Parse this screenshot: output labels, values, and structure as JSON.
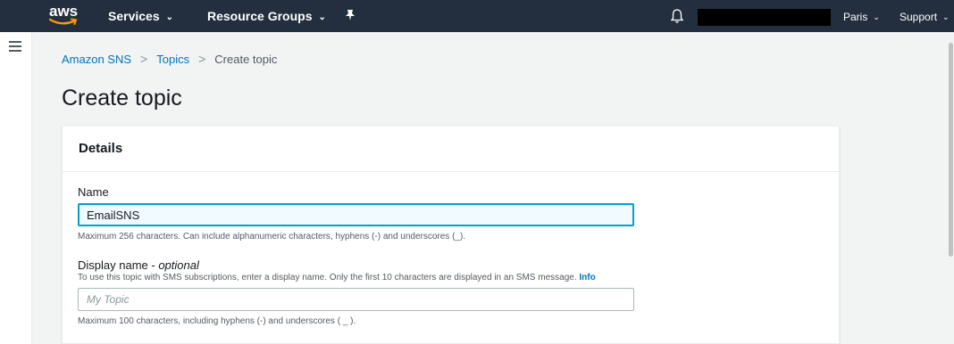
{
  "topnav": {
    "logo_text": "aws",
    "services_label": "Services",
    "resource_groups_label": "Resource Groups",
    "region_label": "Paris",
    "support_label": "Support",
    "caret": "⌄",
    "pin_icon": "pin-icon",
    "bell_icon": "bell-icon"
  },
  "breadcrumb": {
    "items": [
      "Amazon SNS",
      "Topics",
      "Create topic"
    ],
    "separator": ">"
  },
  "page_title": "Create topic",
  "details": {
    "title": "Details",
    "name": {
      "label": "Name",
      "value": "EmailSNS",
      "description": "Maximum 256 characters. Can include alphanumeric characters, hyphens (-) and underscores (_)."
    },
    "display_name": {
      "label": "Display name - ",
      "label_optional": "optional",
      "description": "To use this topic with SMS subscriptions, enter a display name. Only the first 10 characters are displayed in an SMS message.",
      "info_link": "Info",
      "placeholder": "My Topic",
      "constraint": "Maximum 100 characters, including hyphens (-) and underscores ( _ )."
    }
  },
  "colors": {
    "nav_bg": "#232f3e",
    "link": "#0073bb",
    "focus_border": "#00a1c9",
    "logo_smile": "#ff9900"
  }
}
